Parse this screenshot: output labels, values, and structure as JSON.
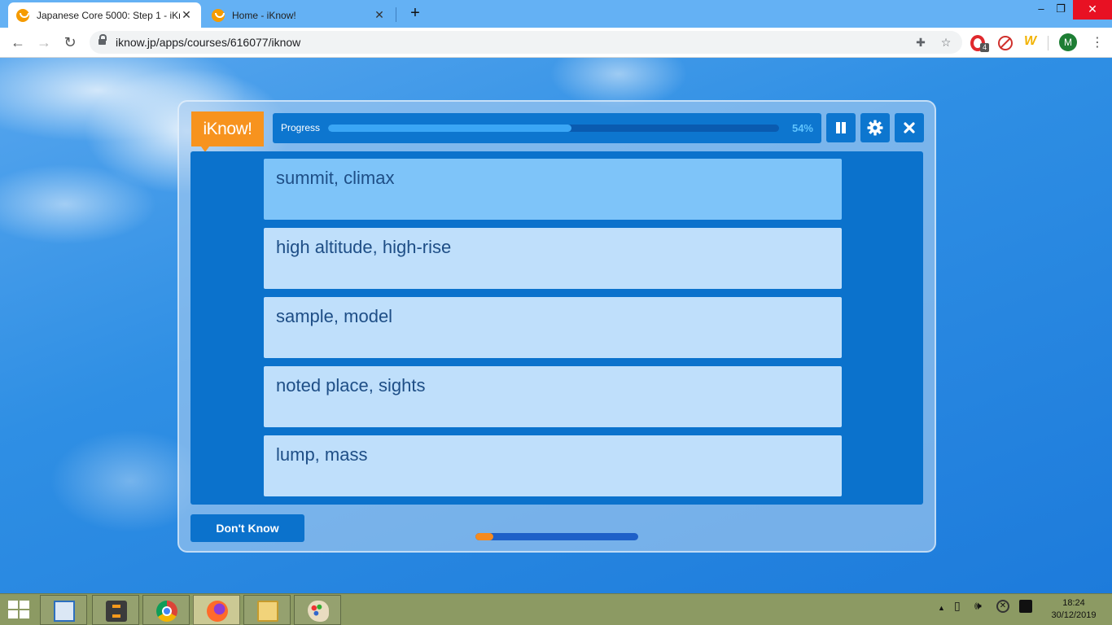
{
  "browser": {
    "tabs": [
      {
        "title": "Japanese Core 5000: Step 1 - iKn",
        "active": true
      },
      {
        "title": "Home - iKnow!",
        "active": false
      }
    ],
    "url": "iknow.jp/apps/courses/616077/iknow",
    "extension_badge": "4",
    "profile_initial": "M"
  },
  "app": {
    "logo_text": "iKnow!",
    "progress": {
      "label": "Progress",
      "percent_text": "54%",
      "value": 0.54
    },
    "options": [
      "summit, climax",
      "high altitude, high-rise",
      "sample, model",
      "noted place, sights",
      "lump, mass"
    ],
    "dont_know_label": "Don't Know",
    "timer_fraction": 0.11
  },
  "taskbar": {
    "time": "18:24",
    "date": "30/12/2019"
  },
  "colors": {
    "accent_orange": "#f7931e",
    "panel_blue": "#0b72cc",
    "option_bg": "#bfdffb",
    "option_highlight": "#7ec4f9",
    "option_text": "#1e4e86"
  }
}
